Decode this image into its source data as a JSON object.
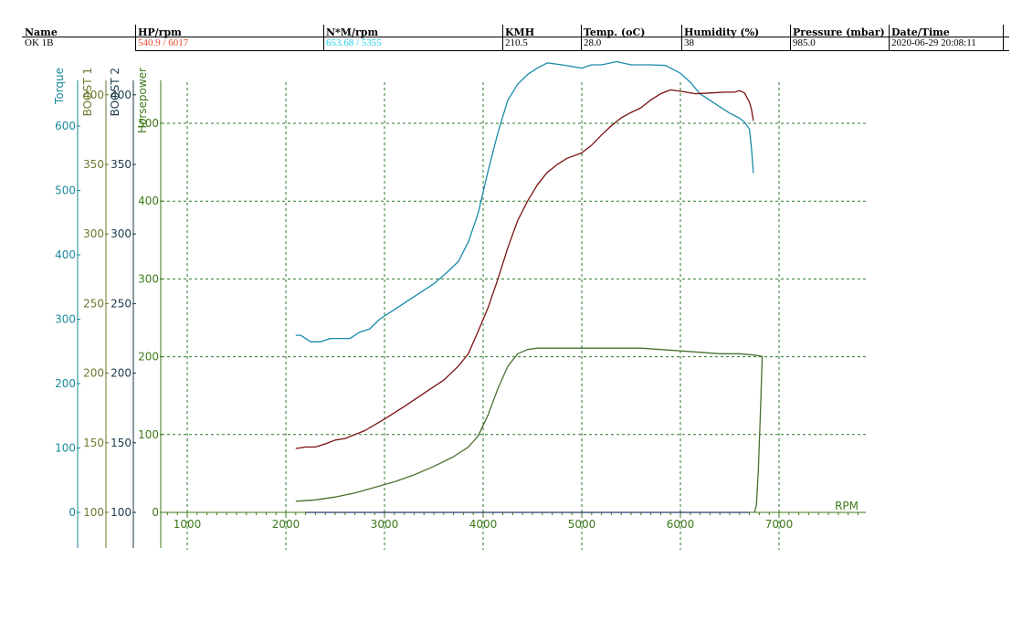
{
  "header": {
    "columns": [
      {
        "label": "Name",
        "value": "OK 1B",
        "color": "#000000"
      },
      {
        "label": "HP/rpm",
        "value": "540.9 / 6017",
        "color": "#e8452e"
      },
      {
        "label": "N*M/rpm",
        "value": "653.68 / 5355",
        "color": "#22d3e8"
      },
      {
        "label": "KMH",
        "value": "210.5",
        "color": "#000000"
      },
      {
        "label": "Temp. (oC)",
        "value": "28.0",
        "color": "#000000"
      },
      {
        "label": "Humidity (%)",
        "value": " 38",
        "color": "#000000"
      },
      {
        "label": "Pressure (mbar)",
        "value": "985.0",
        "color": "#000000"
      },
      {
        "label": "Date/Time",
        "value": "2020-06-29 20:08:11",
        "color": "#000000"
      }
    ]
  },
  "chart_data": {
    "type": "line",
    "xlabel": "RPM",
    "xlim": [
      800,
      7880
    ],
    "xticks": [
      1000,
      2000,
      3000,
      4000,
      5000,
      6000,
      7000
    ],
    "grid": true,
    "axes": [
      {
        "name": "Torque",
        "color": "#1a8a9a",
        "ticks": [
          0,
          100,
          200,
          300,
          400,
          500,
          600
        ],
        "range": [
          0,
          700
        ]
      },
      {
        "name": "BOOST 1",
        "color": "#6b7a2e",
        "ticks": [
          100,
          150,
          200,
          250,
          300,
          350,
          400
        ],
        "range": [
          100,
          400
        ]
      },
      {
        "name": "BOOST 2",
        "color": "#1a3a4a",
        "ticks": [
          100,
          150,
          200,
          250,
          300,
          350,
          400
        ],
        "range": [
          100,
          400
        ]
      },
      {
        "name": "Horsepower",
        "color": "#3d7a1a",
        "ticks": [
          0,
          100,
          200,
          300,
          400,
          500
        ],
        "range": [
          0,
          550
        ]
      }
    ],
    "series": [
      {
        "color": "#1a8aaa",
        "axis": "Torque",
        "x": [
          2100,
          2150,
          2250,
          2350,
          2450,
          2550,
          2650,
          2750,
          2850,
          2950,
          3100,
          3300,
          3500,
          3650,
          3750,
          3850,
          3950,
          4050,
          4150,
          4250,
          4350,
          4450,
          4550,
          4650,
          4800,
          5000,
          5100,
          5200,
          5355,
          5500,
          5700,
          5850,
          6000,
          6100,
          6200,
          6300,
          6400,
          6500,
          6600,
          6650,
          6700,
          6720,
          6740
        ],
        "y": [
          275,
          275,
          265,
          265,
          270,
          270,
          270,
          280,
          285,
          300,
          315,
          335,
          355,
          375,
          390,
          420,
          465,
          530,
          590,
          640,
          665,
          680,
          690,
          698,
          695,
          690,
          695,
          695,
          700,
          695,
          695,
          694,
          682,
          668,
          650,
          640,
          630,
          620,
          612,
          606,
          595,
          565,
          527
        ]
      },
      {
        "color": "#7a1010",
        "axis": "Horsepower",
        "x": [
          2100,
          2200,
          2300,
          2400,
          2500,
          2600,
          2800,
          3000,
          3200,
          3400,
          3600,
          3750,
          3850,
          3950,
          4050,
          4150,
          4250,
          4350,
          4450,
          4550,
          4650,
          4750,
          4850,
          5000,
          5100,
          5200,
          5300,
          5400,
          5500,
          5600,
          5700,
          5800,
          5900,
          6017,
          6150,
          6300,
          6450,
          6550,
          6600,
          6650,
          6700,
          6720,
          6740
        ],
        "y": [
          82,
          84,
          84,
          88,
          93,
          95,
          105,
          120,
          136,
          153,
          170,
          188,
          204,
          233,
          263,
          300,
          340,
          375,
          400,
          421,
          437,
          447,
          455,
          462,
          472,
          485,
          497,
          507,
          514,
          520,
          530,
          538,
          543,
          541,
          538,
          539,
          540,
          540,
          542,
          539,
          527,
          518,
          503
        ]
      },
      {
        "color": "#4a7030",
        "axis": "BOOST 1",
        "x": [
          2100,
          2300,
          2500,
          2700,
          2900,
          3100,
          3300,
          3500,
          3700,
          3850,
          3950,
          4050,
          4150,
          4250,
          4350,
          4450,
          4550,
          4700,
          5000,
          5300,
          5600,
          5800,
          6000,
          6200,
          6400,
          6600,
          6750,
          6830,
          6810,
          6790,
          6770,
          6750
        ],
        "y": [
          108,
          109,
          111,
          114,
          118,
          122,
          127,
          133,
          140,
          147,
          155,
          170,
          189,
          205,
          214,
          217,
          218,
          218,
          218,
          218,
          218,
          217,
          216,
          215,
          214,
          214,
          213,
          212,
          170,
          130,
          105,
          100
        ]
      },
      {
        "color": "#2a3a6a",
        "axis": "BOOST 2",
        "x": [
          2200,
          3000,
          3500,
          4000,
          4500,
          5000,
          5500,
          6000,
          6500,
          6700
        ],
        "y": [
          100,
          100,
          100,
          100,
          100,
          100,
          100,
          100,
          100,
          100
        ]
      }
    ]
  }
}
